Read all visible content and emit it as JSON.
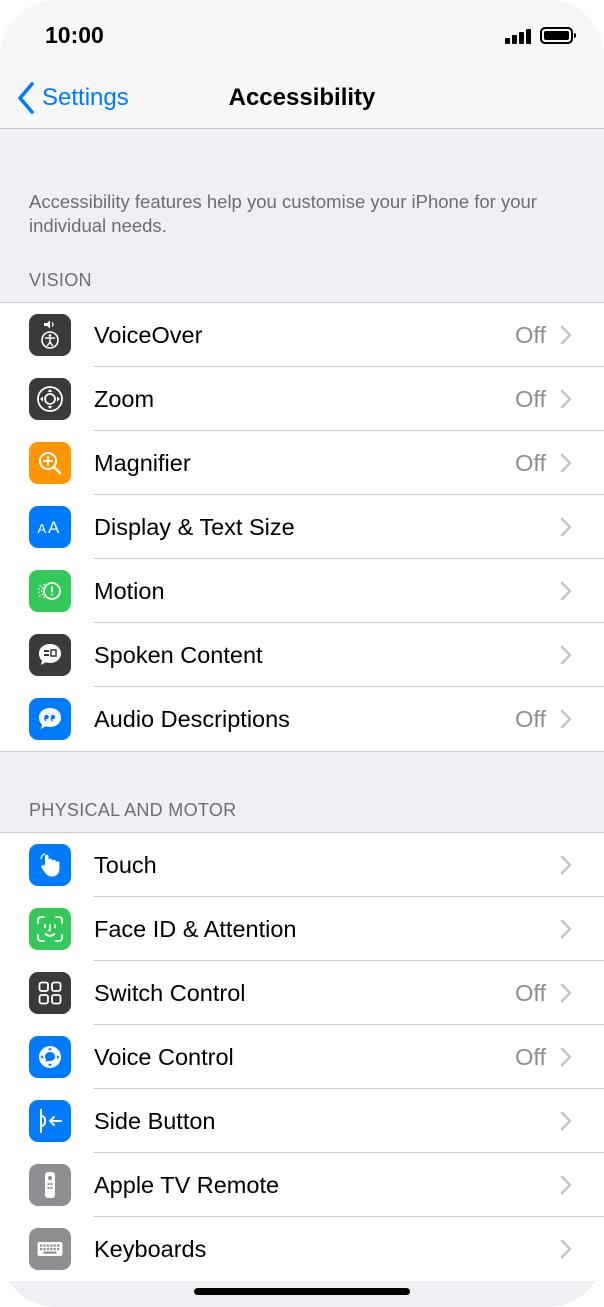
{
  "status_bar": {
    "time": "10:00"
  },
  "nav": {
    "back_label": "Settings",
    "title": "Accessibility"
  },
  "intro": "Accessibility features help you customise your iPhone for your individual needs.",
  "sections": [
    {
      "header": "VISION",
      "rows": [
        {
          "label": "VoiceOver",
          "value": "Off",
          "icon": "voiceover-icon",
          "color": "#3a3a3c"
        },
        {
          "label": "Zoom",
          "value": "Off",
          "icon": "zoom-icon",
          "color": "#3a3a3c"
        },
        {
          "label": "Magnifier",
          "value": "Off",
          "icon": "magnifier-icon",
          "color": "#ff9500"
        },
        {
          "label": "Display & Text Size",
          "value": "",
          "icon": "display-text-size-icon",
          "color": "#007aff"
        },
        {
          "label": "Motion",
          "value": "",
          "icon": "motion-icon",
          "color": "#34c759"
        },
        {
          "label": "Spoken Content",
          "value": "",
          "icon": "spoken-content-icon",
          "color": "#3a3a3c"
        },
        {
          "label": "Audio Descriptions",
          "value": "Off",
          "icon": "audio-descriptions-icon",
          "color": "#007aff"
        }
      ]
    },
    {
      "header": "PHYSICAL AND MOTOR",
      "rows": [
        {
          "label": "Touch",
          "value": "",
          "icon": "touch-icon",
          "color": "#007aff"
        },
        {
          "label": "Face ID & Attention",
          "value": "",
          "icon": "face-id-icon",
          "color": "#34c759"
        },
        {
          "label": "Switch Control",
          "value": "Off",
          "icon": "switch-control-icon",
          "color": "#3a3a3c"
        },
        {
          "label": "Voice Control",
          "value": "Off",
          "icon": "voice-control-icon",
          "color": "#007aff"
        },
        {
          "label": "Side Button",
          "value": "",
          "icon": "side-button-icon",
          "color": "#007aff"
        },
        {
          "label": "Apple TV Remote",
          "value": "",
          "icon": "apple-tv-remote-icon",
          "color": "#8e8e93"
        },
        {
          "label": "Keyboards",
          "value": "",
          "icon": "keyboards-icon",
          "color": "#8e8e93"
        }
      ]
    }
  ],
  "colors": {
    "accent": "#007aff",
    "group_background": "#efeff4",
    "secondary_text": "#6d6d72"
  }
}
